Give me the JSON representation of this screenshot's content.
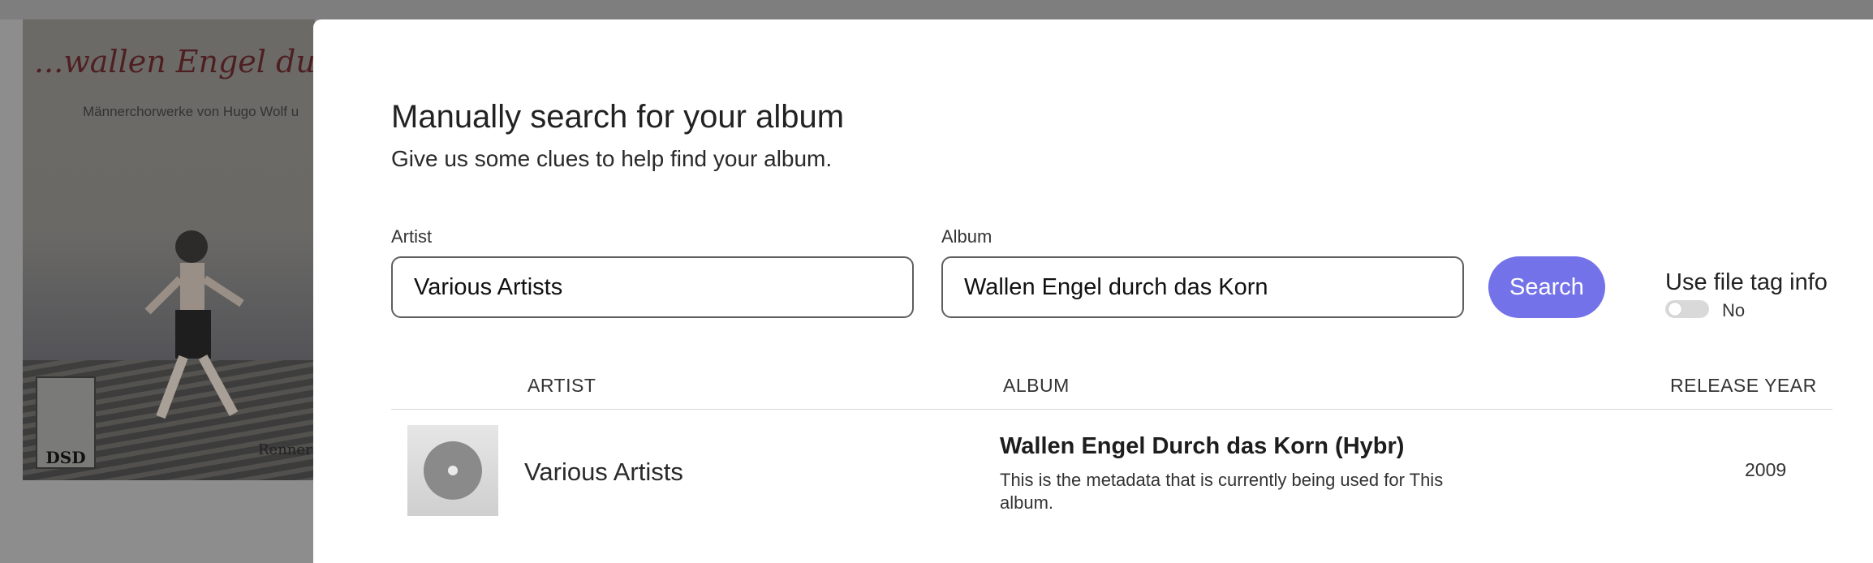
{
  "background": {
    "art_title": "...wallen Engel durch",
    "art_subtitle": "Männerchorwerke von Hugo Wolf u",
    "art_logo_text": "DSD",
    "art_corner_text": "Renner"
  },
  "modal": {
    "title": "Manually search for your album",
    "subtitle": "Give us some clues to help find your album."
  },
  "form": {
    "artist_label": "Artist",
    "artist_value": "Various Artists",
    "album_label": "Album",
    "album_value": "Wallen Engel durch das Korn",
    "search_label": "Search",
    "file_tag_label": "Use file tag info",
    "file_tag_state": "No"
  },
  "results": {
    "columns": {
      "artist": "ARTIST",
      "album": "ALBUM",
      "year": "RELEASE YEAR"
    },
    "rows": [
      {
        "artist": "Various Artists",
        "album": "Wallen Engel Durch das Korn (Hybr)",
        "description": "This is the metadata that is currently being used for This album.",
        "year": "2009",
        "thumbnail_icon": "disc-icon"
      }
    ]
  },
  "colors": {
    "accent": "#7472e8",
    "overlay": "#8d8d8d"
  }
}
